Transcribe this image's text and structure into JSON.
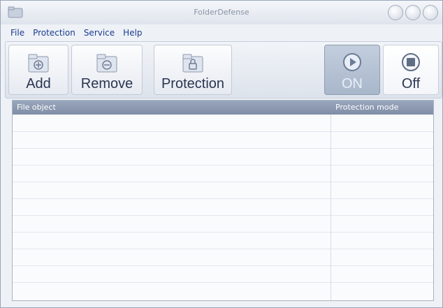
{
  "window": {
    "title": "FolderDefense"
  },
  "menu": [
    "File",
    "Protection",
    "Service",
    "Help"
  ],
  "toolbar": {
    "add_label": "Add",
    "remove_label": "Remove",
    "protection_label": "Protection",
    "on_label": "ON",
    "off_label": "Off"
  },
  "list": {
    "columns": [
      "File object",
      "Protection mode"
    ]
  }
}
